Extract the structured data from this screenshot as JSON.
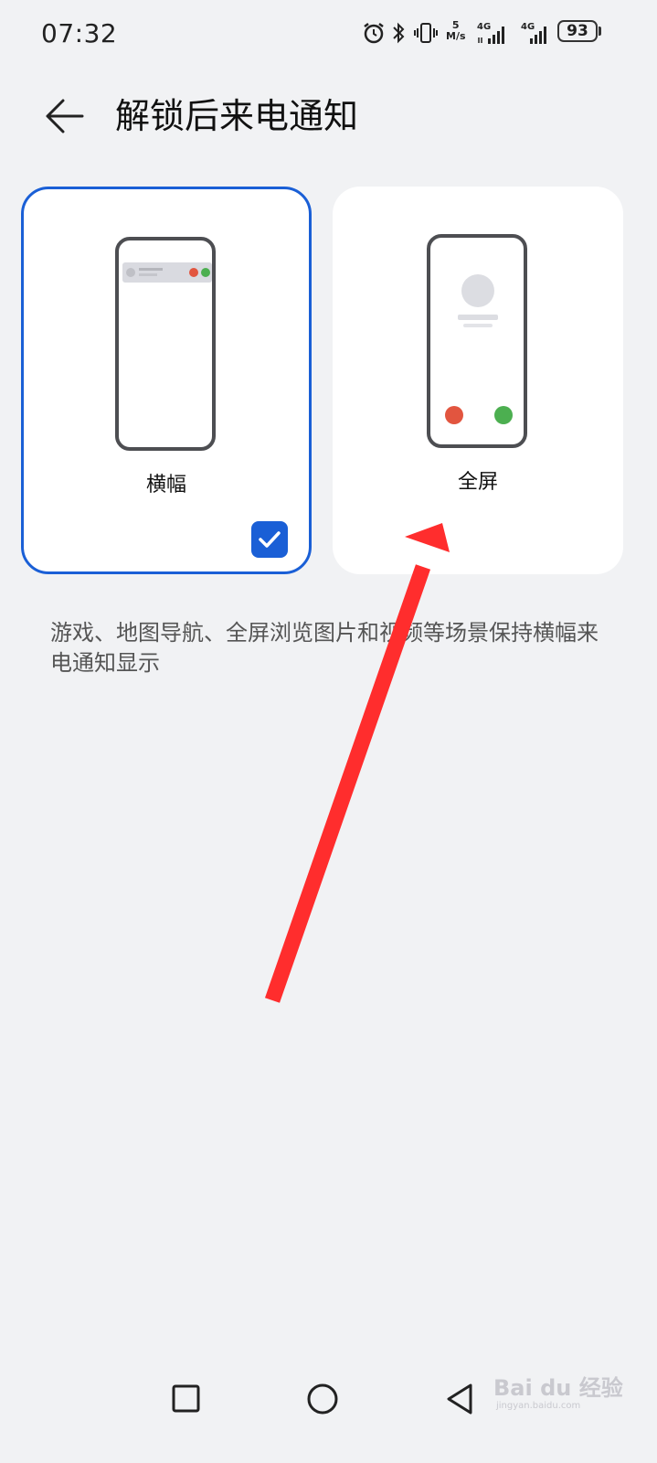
{
  "status_bar": {
    "time": "07:32",
    "net_speed_value": "5",
    "net_speed_unit": "M/s",
    "signal1_label": "4G",
    "signal2_label": "4G",
    "battery": "93",
    "icons": [
      "alarm-icon",
      "bluetooth-icon",
      "vibrate-icon",
      "signal-icon",
      "signal-icon",
      "battery-icon"
    ]
  },
  "header": {
    "back_icon": "arrow-left-icon",
    "title": "解锁后来电通知"
  },
  "options": [
    {
      "label": "横幅",
      "selected": true
    },
    {
      "label": "全屏",
      "selected": false
    }
  ],
  "description": "游戏、地图导航、全屏浏览图片和视频等场景保持横幅来电通知显示",
  "annotation": {
    "color": "#ff2d2d"
  },
  "nav_bar": {
    "icons": [
      "recent-apps-icon",
      "home-icon",
      "back-icon"
    ]
  },
  "watermark": {
    "text": "Bai du 经验",
    "sub": "jingyan.baidu.com"
  },
  "colors": {
    "accent": "#1a5fd6",
    "background": "#f1f2f4",
    "decline": "#e2553f",
    "accept": "#4caf50"
  }
}
